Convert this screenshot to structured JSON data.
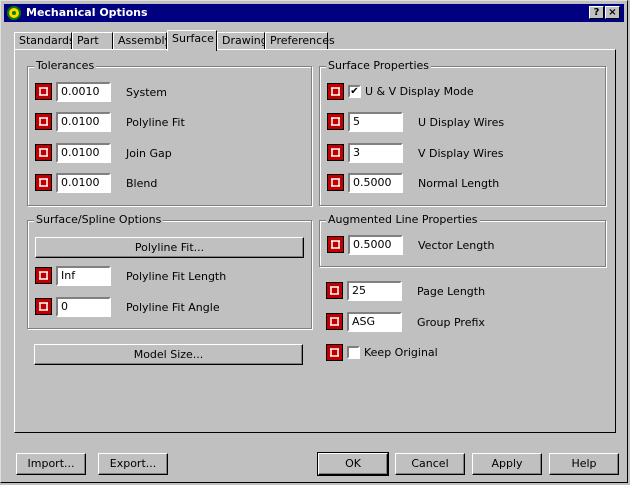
{
  "window": {
    "title": "Mechanical Options",
    "help_button": "?",
    "close_button": "×"
  },
  "tabs": [
    {
      "label": "Standards"
    },
    {
      "label": "Part"
    },
    {
      "label": "Assembly"
    },
    {
      "label": "Surface"
    },
    {
      "label": "Drawing"
    },
    {
      "label": "Preferences"
    }
  ],
  "tolerances": {
    "title": "Tolerances",
    "rows": [
      {
        "value": "0.0010",
        "label": "System"
      },
      {
        "value": "0.0100",
        "label": "Polyline Fit"
      },
      {
        "value": "0.0100",
        "label": "Join Gap"
      },
      {
        "value": "0.0100",
        "label": "Blend"
      }
    ]
  },
  "surface_props": {
    "title": "Surface Properties",
    "uv_display_mode": {
      "label": "U & V Display Mode",
      "checked": true,
      "mark": "✔"
    },
    "rows": [
      {
        "value": "5",
        "label": "U Display Wires"
      },
      {
        "value": "3",
        "label": "V Display Wires"
      },
      {
        "value": "0.5000",
        "label": "Normal Length"
      }
    ]
  },
  "spline_options": {
    "title": "Surface/Spline Options",
    "polyline_fit_button": "Polyline Fit...",
    "rows": [
      {
        "value": "Inf",
        "label": "Polyline Fit Length"
      },
      {
        "value": "0",
        "label": "Polyline Fit Angle"
      }
    ]
  },
  "augmented": {
    "title": "Augmented Line Properties",
    "vector_length": {
      "value": "0.5000",
      "label": "Vector Length"
    }
  },
  "misc": {
    "page_length": {
      "value": "25",
      "label": "Page Length"
    },
    "group_prefix": {
      "value": "ASG",
      "label": "Group Prefix"
    },
    "keep_original": {
      "label": "Keep Original",
      "checked": false
    }
  },
  "model_size_button": "Model Size...",
  "footer": {
    "import": "Import...",
    "export": "Export...",
    "ok": "OK",
    "cancel": "Cancel",
    "apply": "Apply",
    "help": "Help"
  }
}
